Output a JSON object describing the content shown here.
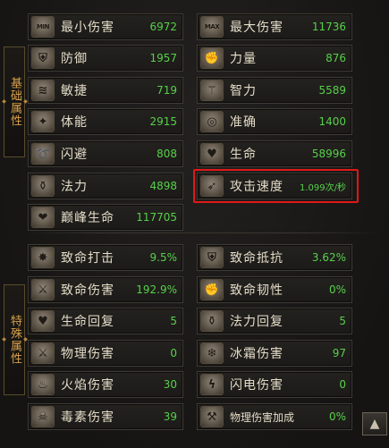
{
  "sections": {
    "basic_label": "基础属性",
    "special_label": "特殊属性"
  },
  "basic": [
    {
      "name": "最小伤害",
      "value": "6972",
      "icon": "min-damage-icon",
      "glyph": "MIN"
    },
    {
      "name": "最大伤害",
      "value": "11736",
      "icon": "max-damage-icon",
      "glyph": "MAX"
    },
    {
      "name": "防御",
      "value": "1957",
      "icon": "shield-icon",
      "glyph": "⛨"
    },
    {
      "name": "力量",
      "value": "876",
      "icon": "fist-icon",
      "glyph": "✊"
    },
    {
      "name": "敏捷",
      "value": "719",
      "icon": "dash-icon",
      "glyph": "≋"
    },
    {
      "name": "智力",
      "value": "5589",
      "icon": "staff-icon",
      "glyph": "⚚"
    },
    {
      "name": "体能",
      "value": "2915",
      "icon": "muscle-icon",
      "glyph": "✦"
    },
    {
      "name": "准确",
      "value": "1400",
      "icon": "target-icon",
      "glyph": "◎"
    },
    {
      "name": "闪避",
      "value": "808",
      "icon": "dodge-icon",
      "glyph": "➰"
    },
    {
      "name": "生命",
      "value": "58996",
      "icon": "heart-icon",
      "glyph": "♥"
    },
    {
      "name": "法力",
      "value": "4898",
      "icon": "potion-icon",
      "glyph": "⚱"
    },
    {
      "name": "攻击速度",
      "value": "1.099次/秒",
      "icon": "attack-speed-icon",
      "glyph": "➶"
    },
    {
      "name": "巅峰生命",
      "value": "117705",
      "icon": "peak-life-icon",
      "glyph": "❤"
    }
  ],
  "special": [
    {
      "name": "致命打击",
      "value": "9.5%",
      "icon": "critical-strike-icon",
      "glyph": "✸"
    },
    {
      "name": "致命抵抗",
      "value": "3.62%",
      "icon": "critical-resist-icon",
      "glyph": "⛨"
    },
    {
      "name": "致命伤害",
      "value": "192.9%",
      "icon": "critical-damage-icon",
      "glyph": "⚔"
    },
    {
      "name": "致命韧性",
      "value": "0%",
      "icon": "toughness-icon",
      "glyph": "✊"
    },
    {
      "name": "生命回复",
      "value": "5",
      "icon": "life-regen-icon",
      "glyph": "♥"
    },
    {
      "name": "法力回复",
      "value": "5",
      "icon": "mana-regen-icon",
      "glyph": "⚱"
    },
    {
      "name": "物理伤害",
      "value": "0",
      "icon": "sword-icon",
      "glyph": "⚔"
    },
    {
      "name": "冰霜伤害",
      "value": "97",
      "icon": "frost-icon",
      "glyph": "❄"
    },
    {
      "name": "火焰伤害",
      "value": "30",
      "icon": "fire-icon",
      "glyph": "♨"
    },
    {
      "name": "闪电伤害",
      "value": "0",
      "icon": "lightning-icon",
      "glyph": "ϟ"
    },
    {
      "name": "毒素伤害",
      "value": "39",
      "icon": "skull-icon",
      "glyph": "☠"
    },
    {
      "name": "物理伤害加成",
      "value": "0%",
      "icon": "physical-bonus-icon",
      "glyph": "⚒"
    }
  ],
  "scroll_button": {
    "glyph": "▲",
    "icon": "scroll-up-icon"
  },
  "colors": {
    "value_green": "#57d04a",
    "highlight_red": "#e01818",
    "label_gold": "#d9a04a"
  }
}
